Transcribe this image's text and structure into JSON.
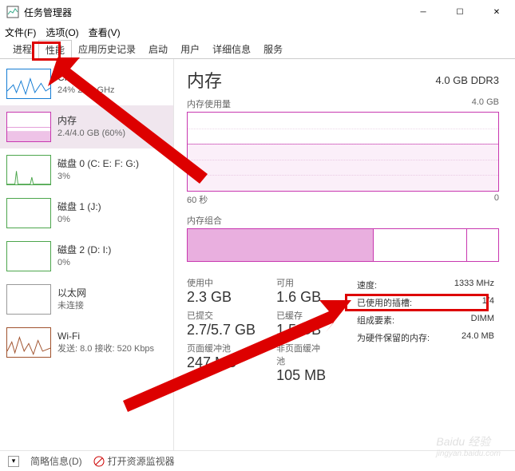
{
  "window": {
    "title": "任务管理器"
  },
  "menu": {
    "file": "文件(F)",
    "options": "选项(O)",
    "view": "查看(V)"
  },
  "tabs": {
    "processes": "进程",
    "performance": "性能",
    "app_history": "应用历史记录",
    "startup": "启动",
    "users": "用户",
    "details": "详细信息",
    "services": "服务"
  },
  "sidebar": {
    "items": [
      {
        "name": "CPU",
        "sub": "24% 2.60 GHz"
      },
      {
        "name": "内存",
        "sub": "2.4/4.0 GB (60%)"
      },
      {
        "name": "磁盘 0 (C: E: F: G:)",
        "sub": "3%"
      },
      {
        "name": "磁盘 1 (J:)",
        "sub": "0%"
      },
      {
        "name": "磁盘 2 (D: I:)",
        "sub": "0%"
      },
      {
        "name": "以太网",
        "sub": "未连接"
      },
      {
        "name": "Wi-Fi",
        "sub": "发送: 8.0 接收: 520 Kbps"
      }
    ]
  },
  "detail": {
    "title": "内存",
    "spec": "4.0 GB DDR3",
    "usage_label": "内存使用量",
    "usage_max": "4.0 GB",
    "axis_left": "60 秒",
    "axis_right": "0",
    "composition_label": "内存组合",
    "stats": {
      "in_use_label": "使用中",
      "in_use": "2.3 GB",
      "available_label": "可用",
      "available": "1.6 GB",
      "committed_label": "已提交",
      "committed": "2.7/5.7 GB",
      "cached_label": "已缓存",
      "cached": "1.5 GB",
      "paged_label": "页面缓冲池",
      "paged": "247 MB",
      "nonpaged_label": "非页面缓冲池",
      "nonpaged": "105 MB"
    },
    "spec_table": {
      "speed_label": "速度:",
      "speed": "1333 MHz",
      "slots_label": "已使用的插槽:",
      "slots": "1/4",
      "form_label": "组成要素:",
      "form": "DIMM",
      "reserved_label": "为硬件保留的内存:",
      "reserved": "24.0 MB"
    }
  },
  "statusbar": {
    "fewer": "简略信息(D)",
    "resmon": "打开资源监视器"
  },
  "watermark": {
    "main": "Baidu 经验",
    "sub": "jingyan.baidu.com"
  },
  "chart_data": {
    "type": "area",
    "title": "内存使用量",
    "xlabel": "60 秒",
    "ylabel": "GB",
    "ylim": [
      0,
      4.0
    ],
    "x_range_seconds": [
      60,
      0
    ],
    "series": [
      {
        "name": "内存使用量",
        "approx_constant_value_gb": 2.4
      }
    ],
    "composition": {
      "total_gb": 4.0,
      "in_use_gb": 2.3,
      "cached_gb": 1.5,
      "available_gb": 1.6
    }
  }
}
